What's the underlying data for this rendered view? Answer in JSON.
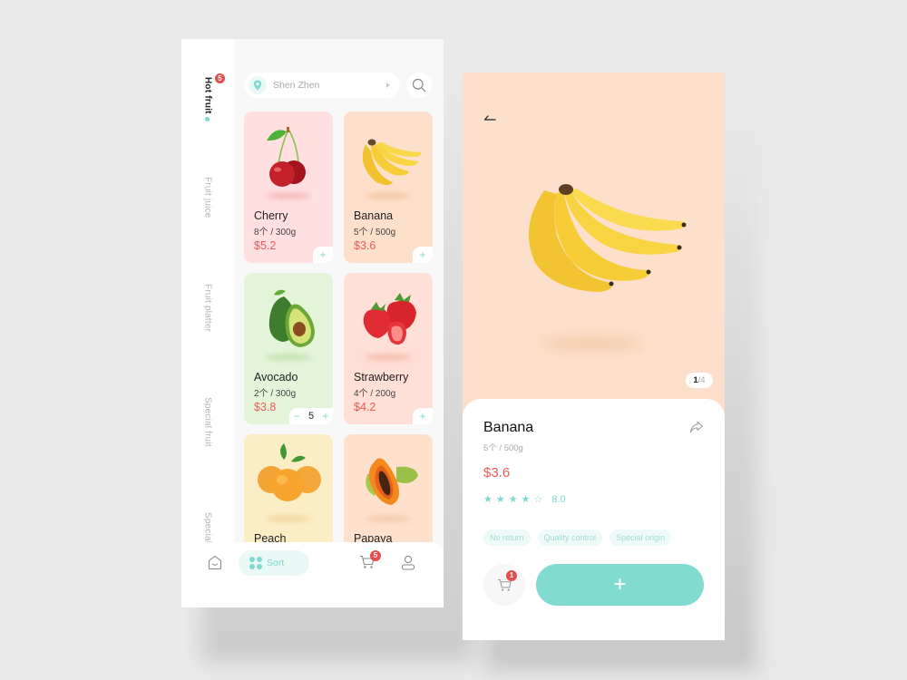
{
  "sidebar": {
    "items": [
      {
        "label": "Hot fruit",
        "active": true,
        "badge": "5"
      },
      {
        "label": "Fruit juice"
      },
      {
        "label": "Fruit platter"
      },
      {
        "label": "Special fruit"
      },
      {
        "label": "Special"
      }
    ]
  },
  "search": {
    "location": "Shen Zhen",
    "location_icon": "location-pin-icon",
    "search_icon": "search-icon"
  },
  "products": [
    {
      "name": "Cherry",
      "spec": "8个 / 300g",
      "price": "$5.2",
      "bg": "#ffdfe0",
      "shadow": "#f3b5b6",
      "add": "+"
    },
    {
      "name": "Banana",
      "spec": "5个 / 500g",
      "price": "$3.6",
      "bg": "#fde0cb",
      "shadow": "#f0c4a0",
      "add": "+"
    },
    {
      "name": "Avocado",
      "spec": "2个 / 300g",
      "price": "$3.8",
      "bg": "#e3f4d9",
      "shadow": "#bfdfae",
      "qty": "5",
      "minus": "−",
      "plus": "+"
    },
    {
      "name": "Strawberry",
      "spec": "4个 / 200g",
      "price": "$4.2",
      "bg": "#ffdfd6",
      "shadow": "#f3b7a8",
      "add": "+"
    },
    {
      "name": "Peach",
      "spec": "",
      "price": "",
      "bg": "#fbedc6",
      "shadow": "#eed59a"
    },
    {
      "name": "Papaya",
      "spec": "",
      "price": "",
      "bg": "#fde1cd",
      "shadow": "#f0c7a8"
    }
  ],
  "bottom_nav": {
    "home_icon": "home-icon",
    "sort_label": "Sort",
    "cart_badge": "5",
    "user_icon": "user-icon"
  },
  "detail": {
    "pager_current": "1",
    "pager_total": "/4",
    "name": "Banana",
    "spec": "5个 / 500g",
    "price": "$3.6",
    "rating": "8.0",
    "stars_filled": 4,
    "stars_total": 5,
    "tags": [
      "No return",
      "Quality control",
      "Special origin"
    ],
    "cart_badge": "1",
    "add_label": "+",
    "bg": "#fce0cb",
    "accent": "#82dbd1",
    "price_color": "#ee5a5a"
  }
}
